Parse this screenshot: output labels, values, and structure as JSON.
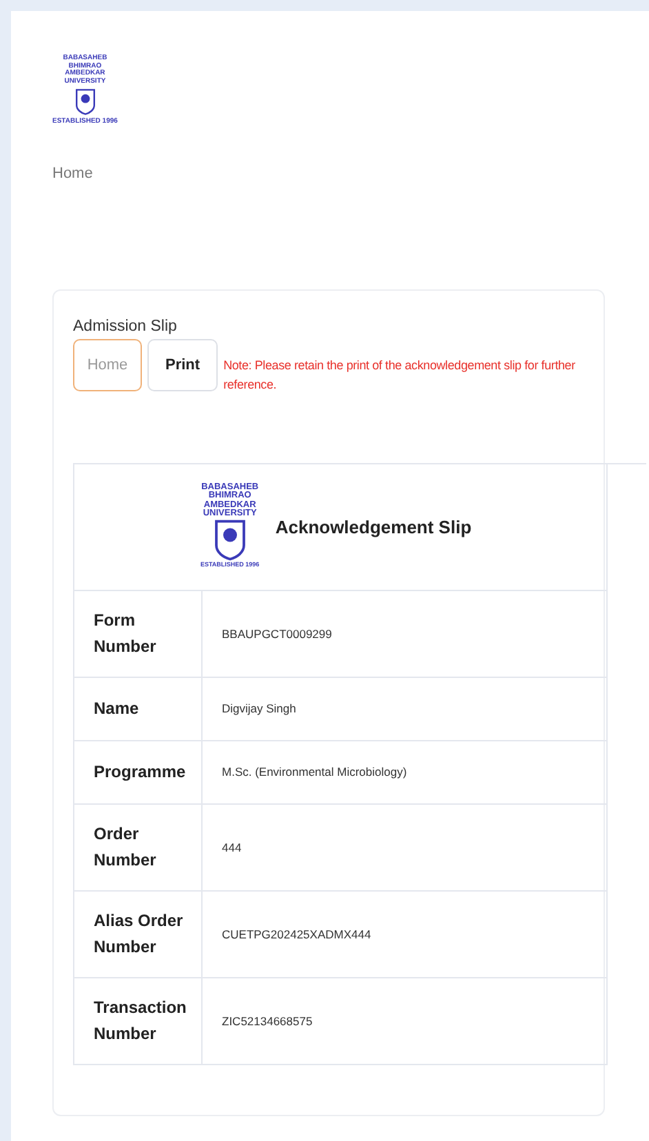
{
  "header": {
    "logo": {
      "lines": [
        "BABASAHEB",
        "BHIMRAO",
        "AMBEDKAR",
        "UNIVERSITY"
      ],
      "established": "ESTABLISHED 1996"
    }
  },
  "breadcrumb": "Home",
  "card": {
    "title": "Admission Slip",
    "buttons": [
      {
        "label": "Home",
        "kind": "outline"
      },
      {
        "label": "Print",
        "kind": "default"
      }
    ],
    "note": "Note: Please retain the print of the acknowledgement slip for further reference."
  },
  "slip": {
    "logo": {
      "lines": [
        "BABASAHEB",
        "BHIMRAO",
        "AMBEDKAR",
        "UNIVERSITY"
      ],
      "established": "ESTABLISHED 1996"
    },
    "title": "Acknowledgement Slip",
    "rows": [
      {
        "label": "Form Number",
        "value": "BBAUPGCT0009299"
      },
      {
        "label": "Name",
        "value": "Digvijay Singh"
      },
      {
        "label": "Programme",
        "value": "M.Sc. (Environmental Microbiology)"
      },
      {
        "label": "Order Number",
        "value": "444"
      },
      {
        "label": "Alias Order Number",
        "value": "CUETPG202425XADMX444"
      },
      {
        "label": "Transaction Number",
        "value": "ZIC52134668575"
      }
    ]
  }
}
